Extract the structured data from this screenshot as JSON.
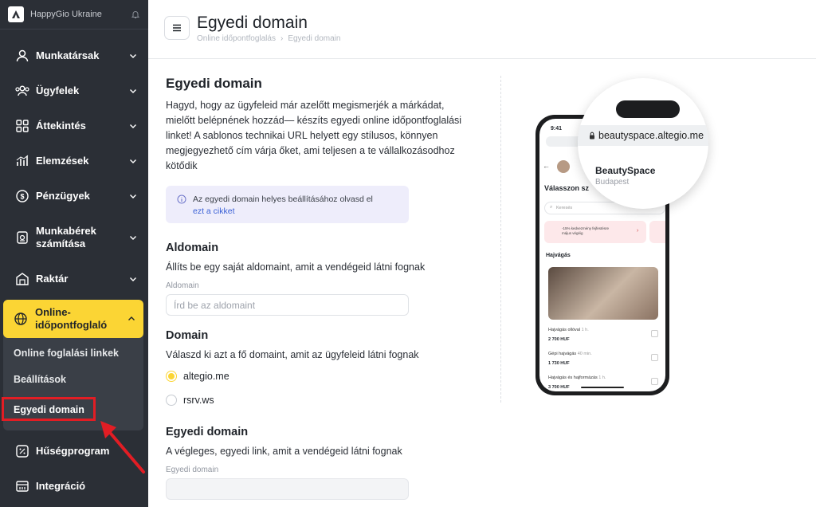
{
  "sidebar": {
    "brand": "HappyGio Ukraine",
    "items": [
      {
        "label": "Munkatársak"
      },
      {
        "label": "Ügyfelek"
      },
      {
        "label": "Áttekintés"
      },
      {
        "label": "Elemzések"
      },
      {
        "label": "Pénzügyek"
      },
      {
        "label": "Munkabérek számítása"
      },
      {
        "label": "Raktár"
      }
    ],
    "active": {
      "label": "Online-időpontfoglaló",
      "sub": [
        "Online foglalási linkek",
        "Beállítások",
        "Egyedi domain"
      ]
    },
    "bottom": [
      {
        "label": "Hűségprogram"
      },
      {
        "label": "Integráció"
      }
    ]
  },
  "header": {
    "title": "Egyedi domain",
    "breadcrumb": [
      "Online időpontfoglalás",
      "Egyedi domain"
    ]
  },
  "main": {
    "title": "Egyedi domain",
    "description": "Hagyd, hogy az ügyfeleid már azelőtt megismerjék a márkádat, mielőtt belépnének hozzád— készíts egyedi online időpontfoglalási linket! A sablonos technikai URL helyett egy stílusos, könnyen megjegyezhető cím várja őket, ami teljesen a te vállalkozásodhoz kötődik",
    "info_text": "Az egyedi domain helyes beállításához olvasd el",
    "info_link": "ezt a cikket",
    "subdomain": {
      "title": "Aldomain",
      "desc": "Állíts be egy saját aldomaint, amit a vendégeid látni fognak",
      "label": "Aldomain",
      "placeholder": "Írd be az aldomaint"
    },
    "domain": {
      "title": "Domain",
      "desc": "Válaszd ki azt a fő domaint, amit az ügyfeleid látni fognak",
      "options": [
        {
          "label": "altegio.me",
          "selected": true
        },
        {
          "label": "rsrv.ws",
          "selected": false
        }
      ]
    },
    "custom": {
      "title": "Egyedi domain",
      "desc": "A végleges, egyedi link, amit a vendégeid látni fognak",
      "label": "Egyedi domain",
      "value": ""
    }
  },
  "phone": {
    "time": "9:41",
    "url": "beautyspace.altegio.me",
    "business": "BeautySpace",
    "city": "Budapest",
    "heading": "Válasszon sz",
    "search": "Keresés",
    "promo": "-15% kedvezmény fejfestésre május végéig",
    "category": "Hajvágás",
    "services": [
      {
        "name": "Hajvágás ollóval",
        "dur": "1 h.",
        "price": "2 700 HUF"
      },
      {
        "name": "Gépi hajvágás",
        "dur": "40 min.",
        "price": "1 730 HUF"
      },
      {
        "name": "Hajvágás és hajformázás",
        "dur": "1 h.",
        "price": "3 700 HUF"
      }
    ]
  },
  "colors": {
    "accent": "#fbd534",
    "sidebar": "#2b2f36",
    "highlight": "#e21d24",
    "link": "#3b61d6"
  }
}
